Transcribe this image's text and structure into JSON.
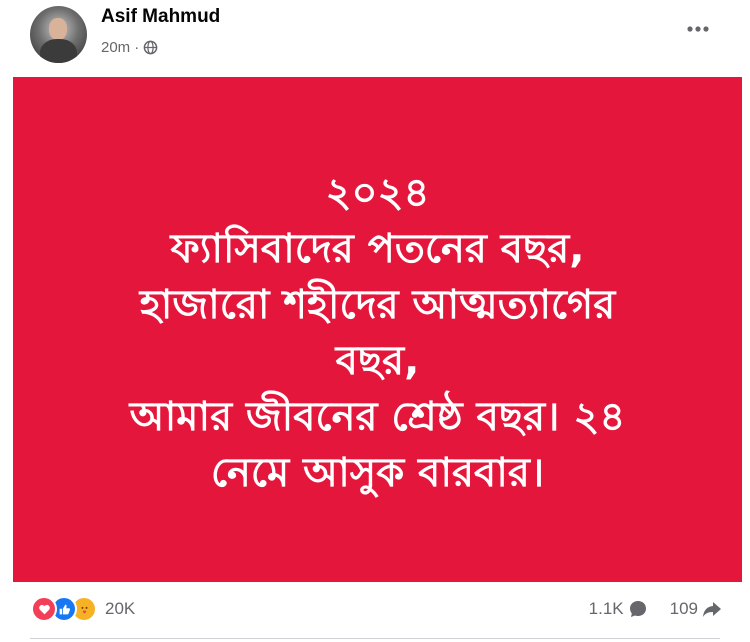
{
  "post": {
    "author": "Asif Mahmud",
    "time": "20m",
    "separator": "·",
    "privacy_icon": "globe-icon",
    "more_icon": "more-options-icon"
  },
  "image": {
    "background_color": "#e5163c",
    "text_color": "#ffffff",
    "lines": [
      "২০২৪",
      "ফ্যাসিবাদের পতনের বছর,",
      "হাজারো শহীদের আত্মত্যাগের",
      "বছর,",
      "আমার জীবনের শ্রেষ্ঠ বছর। ২৪",
      "নেমে আসুক বারবার।"
    ]
  },
  "footer": {
    "reaction_icons": [
      "love-icon",
      "like-icon",
      "care-icon"
    ],
    "reaction_count": "20K",
    "comment_count": "1.1K",
    "share_count": "109"
  }
}
